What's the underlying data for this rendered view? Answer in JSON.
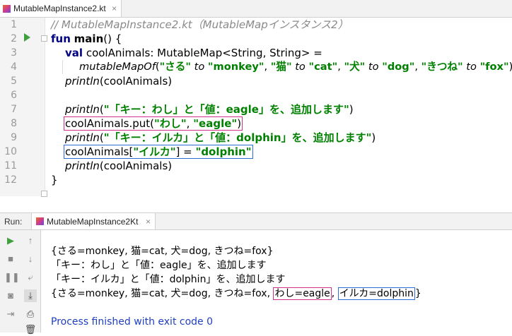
{
  "file_tab": {
    "label": "MutableMapInstance2.kt",
    "close": "×"
  },
  "code": {
    "line_numbers": [
      "1",
      "2",
      "3",
      "4",
      "5",
      "6",
      "7",
      "8",
      "9",
      "10",
      "11",
      "12"
    ],
    "l1": "// MutableMapInstance2.kt（MutableMapインスタンス2）",
    "l2_kw": "fun",
    "l2_name": "main",
    "l2_rest": "() {",
    "l3_kw": "val",
    "l3_rest": "coolAnimals: MutableMap<String, String> =",
    "l4_fn": "mutableMapOf",
    "l4_open": "(",
    "l4_s1": "\"さる\"",
    "l4_to1": "to",
    "l4_s2": "\"monkey\"",
    "l4_c1": ", ",
    "l4_s3": "\"猫\"",
    "l4_to2": "to",
    "l4_s4": "\"cat\"",
    "l4_c2": ", ",
    "l4_s5": "\"犬\"",
    "l4_to3": "to",
    "l4_s6": "\"dog\"",
    "l4_c3": ", ",
    "l4_s7": "\"きつね\"",
    "l4_to4": "to",
    "l4_s8": "\"fox\"",
    "l4_close": ")",
    "l5_fn": "println",
    "l5_arg": "(coolAnimals)",
    "l7_fn": "println",
    "l7_open": "(",
    "l7_str": "\"「キー：わし」と「値：eagle」を、追加します\"",
    "l7_close": ")",
    "l8_pre": "coolAnimals.put(",
    "l8_s1": "\"わし\"",
    "l8_comma": ", ",
    "l8_s2": "\"eagle\"",
    "l8_close": ")",
    "l9_fn": "println",
    "l9_open": "(",
    "l9_str": "\"「キー：イルカ」と「値：dolphin」を、追加します\"",
    "l9_close": ")",
    "l10_pre": "coolAnimals[",
    "l10_key": "\"イルカ\"",
    "l10_mid": "] = ",
    "l10_val": "\"dolphin\"",
    "l11_fn": "println",
    "l11_arg": "(coolAnimals)",
    "l12": "}"
  },
  "run": {
    "label": "Run:",
    "tab_label": "MutableMapInstance2Kt",
    "close": "×"
  },
  "console": {
    "line1": "{さる=monkey, 猫=cat, 犬=dog, きつね=fox}",
    "line2": "「キー：わし」と「値：eagle」を、追加します",
    "line3": "「キー：イルカ」と「値：dolphin」を、追加します",
    "line4_pre": "{さる=monkey, 猫=cat, 犬=dog, きつね=fox, ",
    "line4_eagle": "わし=eagle",
    "line4_comma": ", ",
    "line4_dolphin": "イルカ=dolphin",
    "line4_end": "}",
    "exit": "Process finished with exit code 0"
  },
  "colors": {
    "keyword": "#000080",
    "string": "#008000",
    "comment": "#8a8a8a",
    "pink_box": "#d12f8c",
    "blue_box": "#2a6fd6",
    "exit": "#1f3fbf"
  }
}
